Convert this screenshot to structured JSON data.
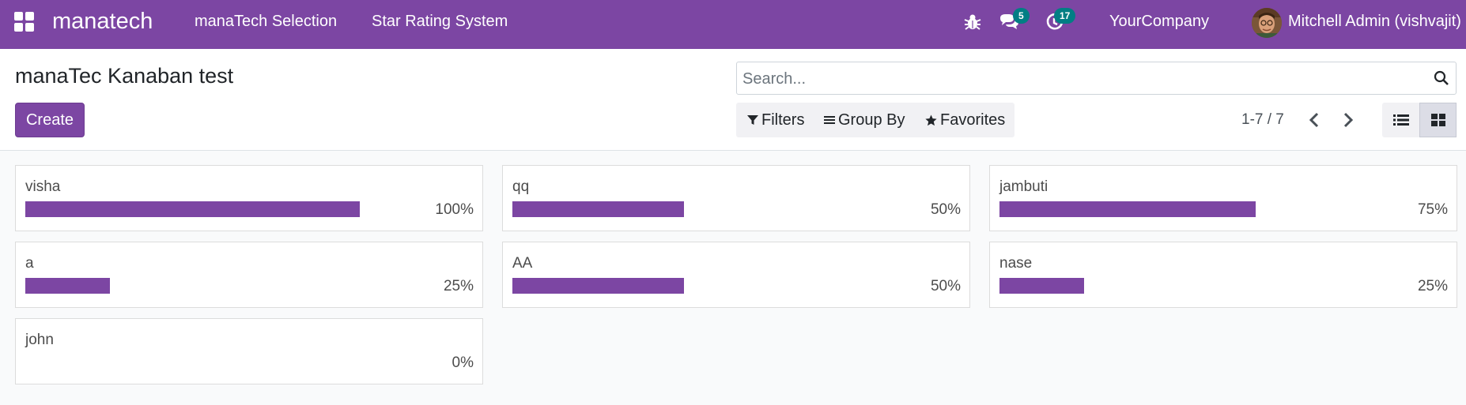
{
  "navbar": {
    "brand": "manatech",
    "menu": [
      "manaTech Selection",
      "Star Rating System"
    ],
    "messages_badge": "5",
    "activities_badge": "17",
    "company": "YourCompany",
    "user": "Mitchell Admin (vishvajit)",
    "icons": [
      "apps-grid-icon",
      "bug-icon",
      "chat-icon",
      "clock-icon"
    ],
    "accent_color": "#7c46a3",
    "badge_color": "#017e84"
  },
  "control_panel": {
    "title": "manaTec Kanaban test",
    "create_label": "Create",
    "search": {
      "placeholder": "Search..."
    },
    "filters_label": "Filters",
    "group_by_label": "Group By",
    "favorites_label": "Favorites",
    "pager": "1-7 / 7",
    "active_view": "kanban"
  },
  "cards": [
    {
      "name": "visha",
      "percent_label": "100%",
      "progress": 0.85
    },
    {
      "name": "qq",
      "percent_label": "50%",
      "progress": 0.435
    },
    {
      "name": "jambuti",
      "percent_label": "75%",
      "progress": 0.65
    },
    {
      "name": "a",
      "percent_label": "25%",
      "progress": 0.215
    },
    {
      "name": "AA",
      "percent_label": "50%",
      "progress": 0.435
    },
    {
      "name": "nase",
      "percent_label": "25%",
      "progress": 0.215
    },
    {
      "name": "john",
      "percent_label": "0%",
      "progress": 0
    }
  ]
}
